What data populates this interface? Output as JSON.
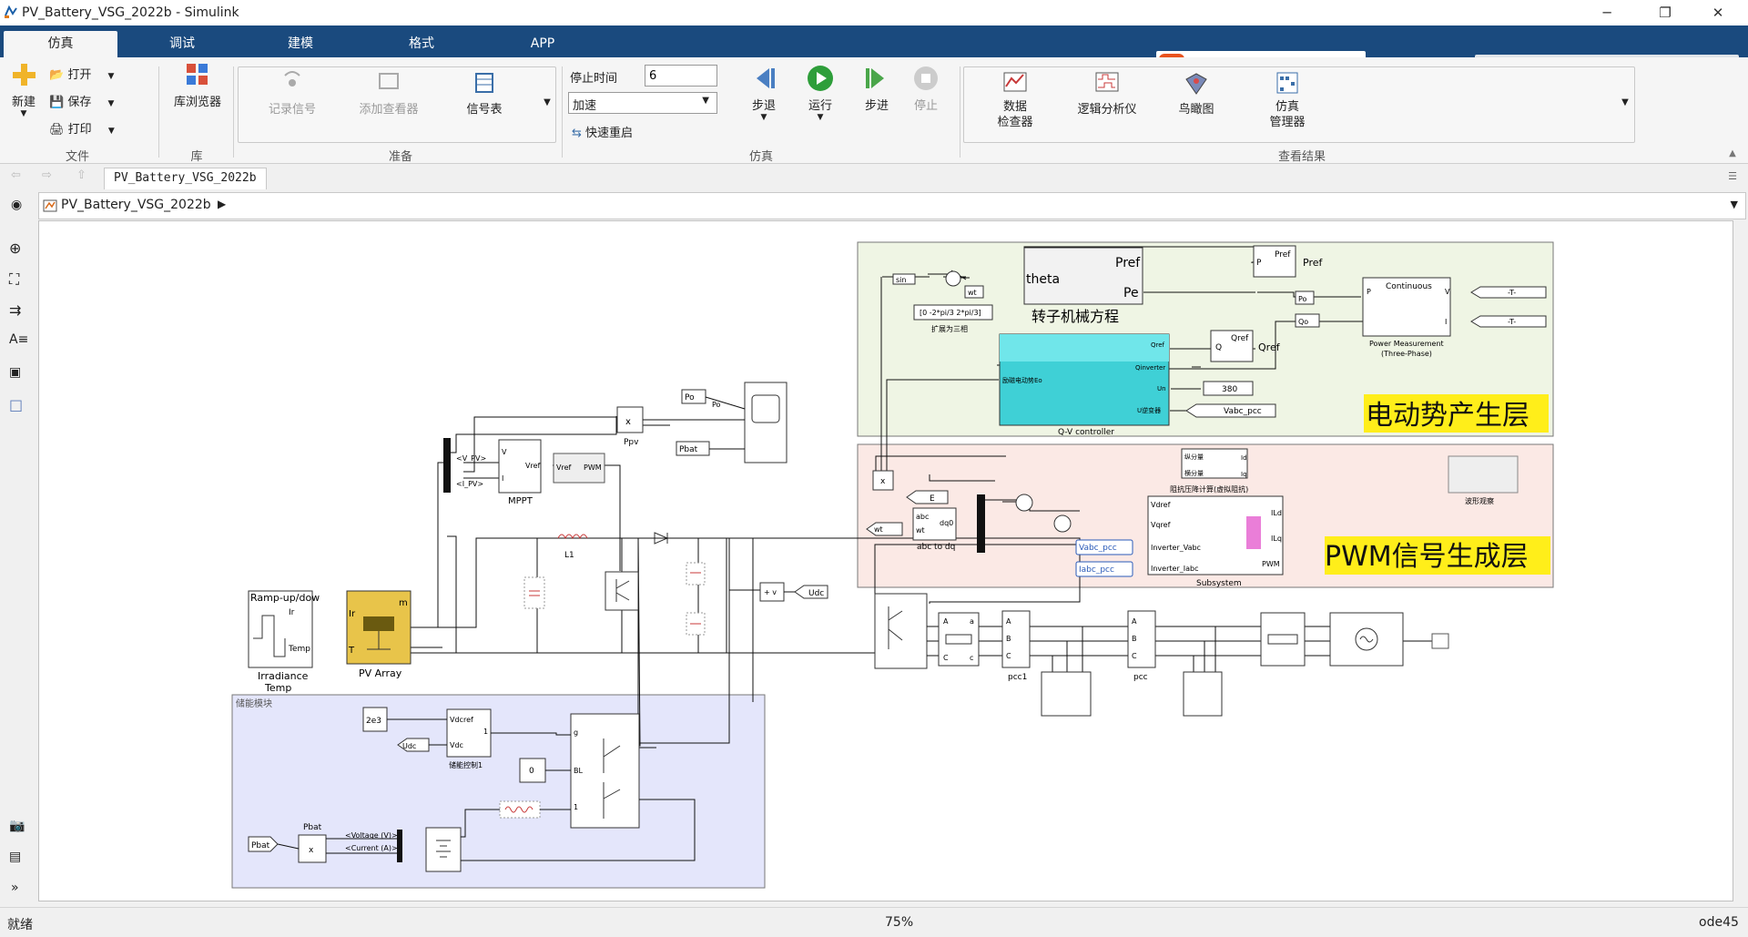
{
  "window": {
    "title": "PV_Battery_VSG_2022b - Simulink",
    "min": "─",
    "max": "❐",
    "close": "✕"
  },
  "tabs": [
    "仿真",
    "调试",
    "建模",
    "格式",
    "APP"
  ],
  "ribbon": {
    "file": {
      "new": "新建",
      "open": "打开",
      "save": "保存",
      "print": "打印",
      "label": "文件"
    },
    "library": {
      "browser": "库浏览器",
      "label": "库"
    },
    "prepare": {
      "log": "记录信号",
      "viewer": "添加查看器",
      "signal_table": "信号表",
      "label": "准备"
    },
    "simulate": {
      "stop_time_label": "停止时间",
      "stop_time": "6",
      "mode": "加速",
      "fast_restart": "快速重启",
      "step_back": "步退",
      "run": "运行",
      "step": "步进",
      "stop": "停止",
      "label": "仿真"
    },
    "results": {
      "data_inspector": "数据\n检查器",
      "logic": "逻辑分析仪",
      "birdseye": "鸟瞰图",
      "sim_manager": "仿真\n管理器",
      "label": "查看结果"
    }
  },
  "breadcrumb": "PV_Battery_VSG_2022b",
  "path": "PV_Battery_VSG_2022b",
  "model": {
    "emf_layer": "电动势产生层",
    "pwm_layer": "PWM信号生成层",
    "storage_label": "储能模块",
    "blocks": {
      "irradiance": "Irradiance\nTemp",
      "ramp": "Ramp-up/dow",
      "pv_array": "PV Array",
      "mppt": "MPPT",
      "ppv": "Ppv",
      "l1": "L1",
      "udc": "Udc",
      "rotor": "转子机械方程",
      "qv": "Q-V controller",
      "power_meas": "Power Measurement\n(Three-Phase)",
      "continuous": "Continuous",
      "expand": "扩展为三相",
      "phase": "[0 -2*pi/3 2*pi/3]",
      "abc_dq": "abc to dq",
      "subsystem": "Subsystem",
      "wave": "波形观察",
      "impedance": "阻抗压降计算(虚拟阻抗)",
      "pcc1": "pcc1",
      "pcc": "pcc",
      "storage_ctrl": "储能控制1",
      "pbat": "Pbat",
      "v380": "380",
      "vabc_pcc": "Vabc_pcc",
      "iabc_pcc": "Iabc_pcc",
      "val2e3": "2e3",
      "zero": "0",
      "voltage": "<Voltage (V)>",
      "current": "<Current (A)>"
    }
  },
  "status": {
    "left": "就绪",
    "zoom": "75%",
    "solver": "ode45"
  }
}
